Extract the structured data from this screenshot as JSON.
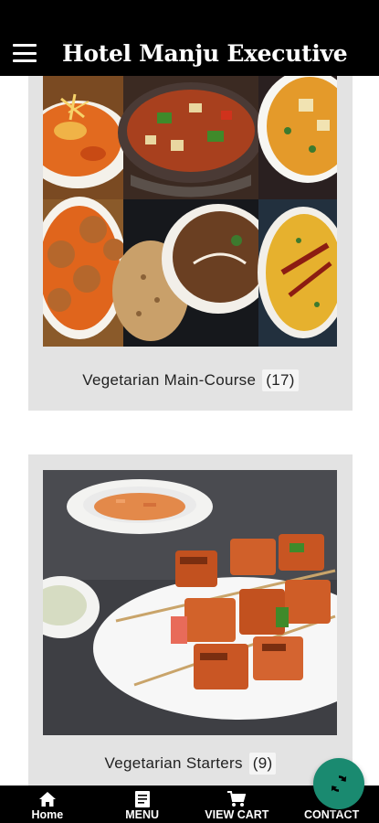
{
  "app": {
    "title": "Hotel Manju Executive"
  },
  "categories": [
    {
      "label": "Vegetarian Main-Course",
      "count": "(17)"
    },
    {
      "label": "Vegetarian Starters",
      "count": "(9)"
    }
  ],
  "bottom_nav": [
    {
      "label": "Home",
      "icon": "home-icon"
    },
    {
      "label": "MENU",
      "icon": "menu-doc-icon"
    },
    {
      "label": "VIEW CART",
      "icon": "cart-icon"
    },
    {
      "label": "CONTACT",
      "icon": "contact-icon"
    }
  ],
  "colors": {
    "bar": "#000000",
    "card": "#e3e3e3",
    "fab": "#1a8a70"
  }
}
